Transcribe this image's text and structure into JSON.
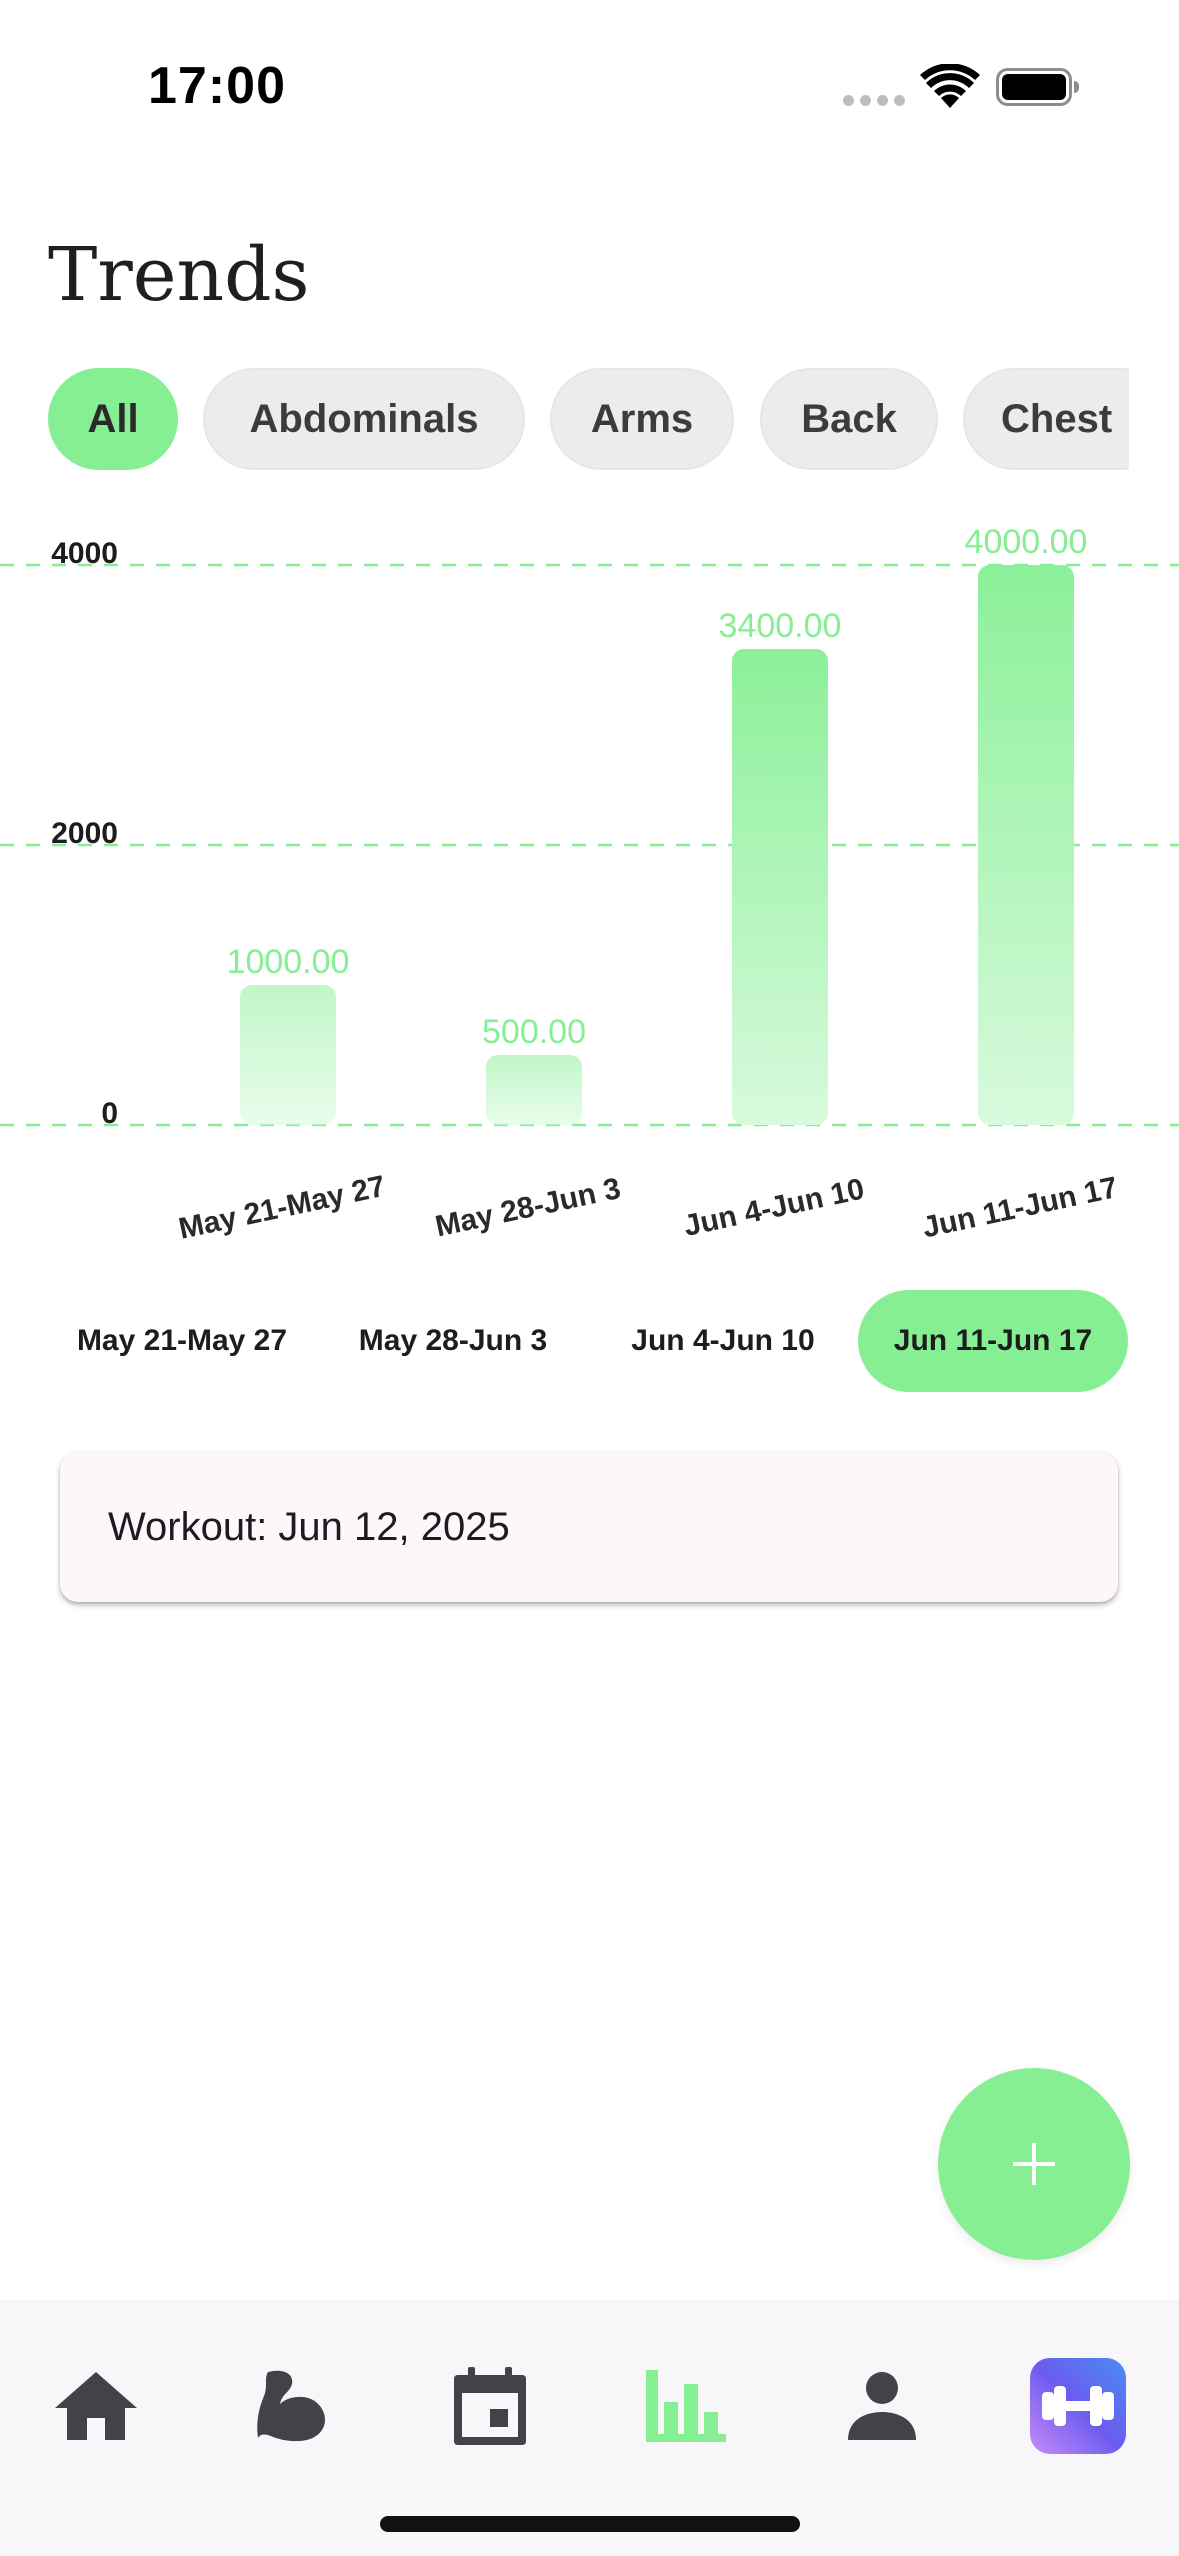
{
  "status_bar": {
    "time": "17:00",
    "icons": [
      "signal-dots-icon",
      "wifi-icon",
      "battery-icon"
    ]
  },
  "page": {
    "title": "Trends"
  },
  "filters": {
    "chips": [
      {
        "label": "All",
        "active": true
      },
      {
        "label": "Abdominals",
        "active": false
      },
      {
        "label": "Arms",
        "active": false
      },
      {
        "label": "Back",
        "active": false
      },
      {
        "label": "Chest",
        "active": false
      }
    ]
  },
  "chart_data": {
    "type": "bar",
    "categories": [
      "May 21-May 27",
      "May 28-Jun 3",
      "Jun 4-Jun 10",
      "Jun 11-Jun 17"
    ],
    "values": [
      1000,
      500,
      3400,
      4000
    ],
    "value_labels": [
      "1000.00",
      "500.00",
      "3400.00",
      "4000.00"
    ],
    "y_ticks": [
      "0",
      "2000",
      "4000"
    ],
    "ylim": [
      0,
      4000
    ],
    "grid": "horizontal dashed",
    "bar_color": "#86ef94",
    "label_color": "#86ef94"
  },
  "weeks": {
    "items": [
      {
        "label": "May 21-May 27",
        "active": false
      },
      {
        "label": "May 28-Jun 3",
        "active": false
      },
      {
        "label": "Jun 4-Jun 10",
        "active": false
      },
      {
        "label": "Jun 11-Jun 17",
        "active": true
      }
    ]
  },
  "workout_card": {
    "text": "Workout: Jun 12, 2025"
  },
  "fab": {
    "icon": "plus-icon"
  },
  "bottom_nav": {
    "items": [
      {
        "icon": "home-icon",
        "active": false
      },
      {
        "icon": "flexed-arm-icon",
        "active": false
      },
      {
        "icon": "calendar-icon",
        "active": false
      },
      {
        "icon": "bar-chart-icon",
        "active": true
      },
      {
        "icon": "person-icon",
        "active": false
      },
      {
        "icon": "dumbbell-app-icon",
        "active": false
      }
    ]
  },
  "colors": {
    "accent": "#86ef94",
    "chip_bg": "#ececec",
    "nav_icon": "#444148",
    "card_bg": "#fdf7fb"
  }
}
